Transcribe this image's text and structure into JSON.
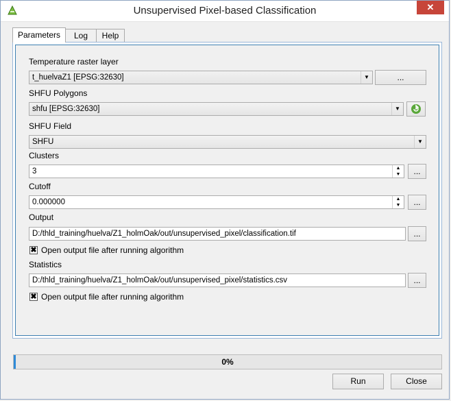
{
  "window": {
    "title": "Unsupervised Pixel-based Classification",
    "close_glyph": "✕"
  },
  "tabs": [
    {
      "label": "Parameters",
      "active": true
    },
    {
      "label": "Log",
      "active": false
    },
    {
      "label": "Help",
      "active": false
    }
  ],
  "params": {
    "temperature": {
      "label": "Temperature raster layer",
      "value": "t_huelvaZ1 [EPSG:32630]",
      "browse": "..."
    },
    "shfu_polygons": {
      "label": "SHFU Polygons",
      "value": "shfu [EPSG:32630]"
    },
    "shfu_field": {
      "label": "SHFU Field",
      "value": "SHFU"
    },
    "clusters": {
      "label": "Clusters",
      "value": "3",
      "browse": "..."
    },
    "cutoff": {
      "label": "Cutoff",
      "value": "0.000000",
      "browse": "..."
    },
    "output": {
      "label": "Output",
      "value": "D:/thld_training/huelva/Z1_holmOak/out/unsupervised_pixel/classification.tif",
      "browse": "...",
      "open_label": "Open output file after running algorithm",
      "open_checked": true
    },
    "statistics": {
      "label": "Statistics",
      "value": "D:/thld_training/huelva/Z1_holmOak/out/unsupervised_pixel/statistics.csv",
      "browse": "...",
      "open_label": "Open output file after running algorithm",
      "open_checked": true
    }
  },
  "progress": {
    "text": "0%",
    "value": 0
  },
  "buttons": {
    "run": "Run",
    "close": "Close"
  },
  "colors": {
    "accent": "#3c7fb1",
    "progress": "#2f8bd8",
    "close": "#c7453a"
  },
  "icons": {
    "app": "qgis-processing-icon",
    "refresh": "refresh-icon"
  }
}
